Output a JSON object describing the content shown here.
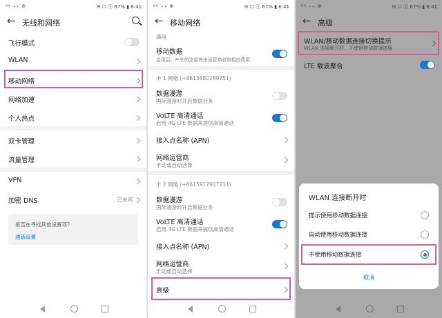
{
  "status": {
    "left": "ᵍᵍ ₊₊ ⊕",
    "right": "✉ ☐ ⓥ 67% ▮ 6:41"
  },
  "panel1": {
    "title": "无线和网络",
    "items": [
      {
        "label": "飞行模式"
      },
      {
        "label": "WLAN"
      },
      {
        "label": "移动网络"
      },
      {
        "label": "网络加速"
      },
      {
        "label": "个人热点"
      },
      {
        "label": "双卡管理"
      },
      {
        "label": "流量管理"
      },
      {
        "label": "VPN"
      },
      {
        "label": "加密 DNS",
        "value": "已关闭"
      }
    ],
    "prompt": {
      "question": "是否在寻找其他设置项？",
      "link": "通话设置"
    }
  },
  "panel2": {
    "title": "移动网络",
    "general_header": "通用",
    "mobile_data": {
      "label": "移动数据",
      "sub": "启用后，产生的流量将由运营商收取相应费用"
    },
    "card1_header": "卡 1 网络 (+8615880280751)",
    "card2_header": "卡 2 网络 (+8615917907211)",
    "roaming": {
      "label": "数据漫游",
      "sub": "国际漫游时开启数据业务"
    },
    "volte": {
      "label": "VoLTE 高清通话",
      "sub": "启用 4G LTE 数据来提供高清通话"
    },
    "apn": "接入点名称 (APN)",
    "operator": {
      "label": "网络运营商",
      "sub": "手动或自动选择"
    },
    "advanced": "高级"
  },
  "panel3": {
    "title": "高级",
    "wlan_switch": {
      "label": "WLAN/移动数据连接切换提示",
      "sub": "WLAN 连接断开时，不使用移动数据连接"
    },
    "lte_ca": "LTE 载波聚合",
    "dialog": {
      "title": "WLAN 连接断开时",
      "options": [
        "提示使用移动数据连接",
        "自动使用移动数据连接",
        "不使用移动数据连接"
      ],
      "cancel": "取消"
    }
  }
}
